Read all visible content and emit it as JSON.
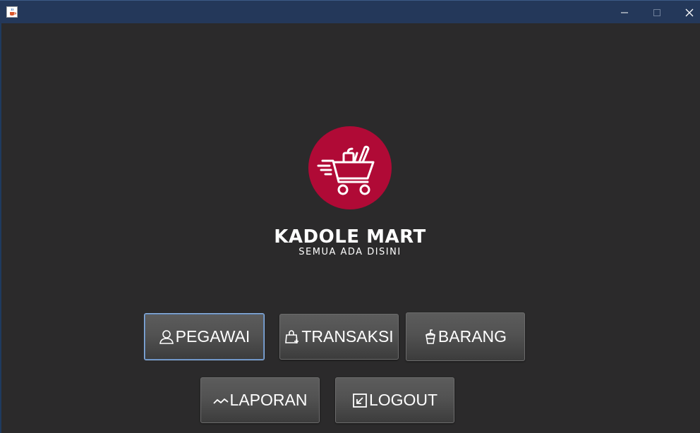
{
  "window": {
    "icon": "java-cup-icon",
    "controls": [
      "minimize-icon",
      "maximize-icon",
      "close-icon"
    ]
  },
  "brand": {
    "name": "KADOLE MART",
    "tagline": "SEMUA ADA DISINI",
    "logo_icon": "shopping-cart-icon",
    "logo_color": "#b00a36"
  },
  "menu": {
    "pegawai": {
      "label": "PEGAWAI",
      "icon": "user-icon"
    },
    "transaksi": {
      "label": "TRANSAKSI",
      "icon": "shopping-bag-icon"
    },
    "barang": {
      "label": "BARANG",
      "icon": "cup-icon"
    },
    "laporan": {
      "label": "LAPORAN",
      "icon": "trend-line-icon"
    },
    "logout": {
      "label": "LOGOUT",
      "icon": "exit-icon"
    }
  },
  "colors": {
    "background": "#2b2a2b",
    "titlebar": "#24385a",
    "focus_border": "#8fb4e2"
  }
}
